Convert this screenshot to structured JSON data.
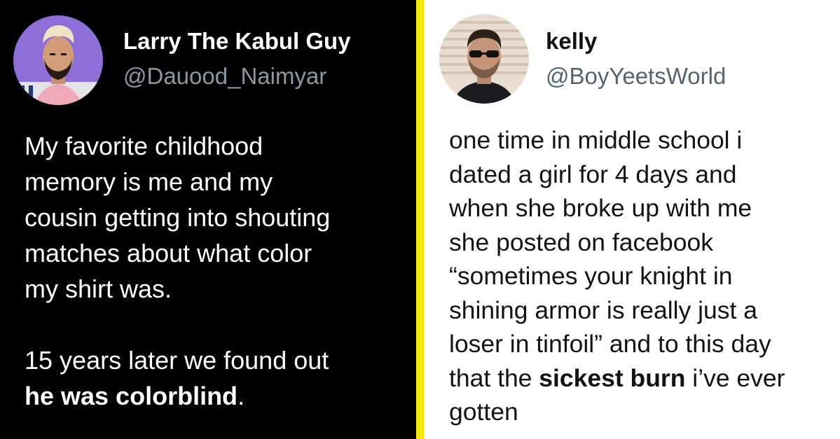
{
  "left_tweet": {
    "display_name": "Larry The Kabul Guy",
    "handle": "@Dauood_Naimyar",
    "lines": [
      "My favorite childhood",
      "memory is me and my",
      "cousin getting into shouting",
      "matches about what color",
      "my shirt was."
    ],
    "punchline_prefix": "15 years later we found out",
    "punchline_bold": "he was colorblind",
    "punchline_suffix": "."
  },
  "right_tweet": {
    "display_name": "kelly",
    "handle": "@BoyYeetsWorld",
    "lines": [
      "one time in middle school i",
      "dated a girl for 4 days and",
      "when she broke up with me",
      "she posted on facebook",
      "“sometimes your knight in",
      "shining armor is really just a",
      "loser in tinfoil” and to this day"
    ],
    "line8_prefix": "that the ",
    "line8_bold": "sickest burn",
    "line8_suffix": " i’ve ever",
    "line9": "gotten"
  },
  "colors": {
    "left_background": "#000000",
    "right_background": "#ffffff",
    "divider": "#f2e90a",
    "left_handle": "#8b98a5",
    "right_handle": "#536471"
  }
}
